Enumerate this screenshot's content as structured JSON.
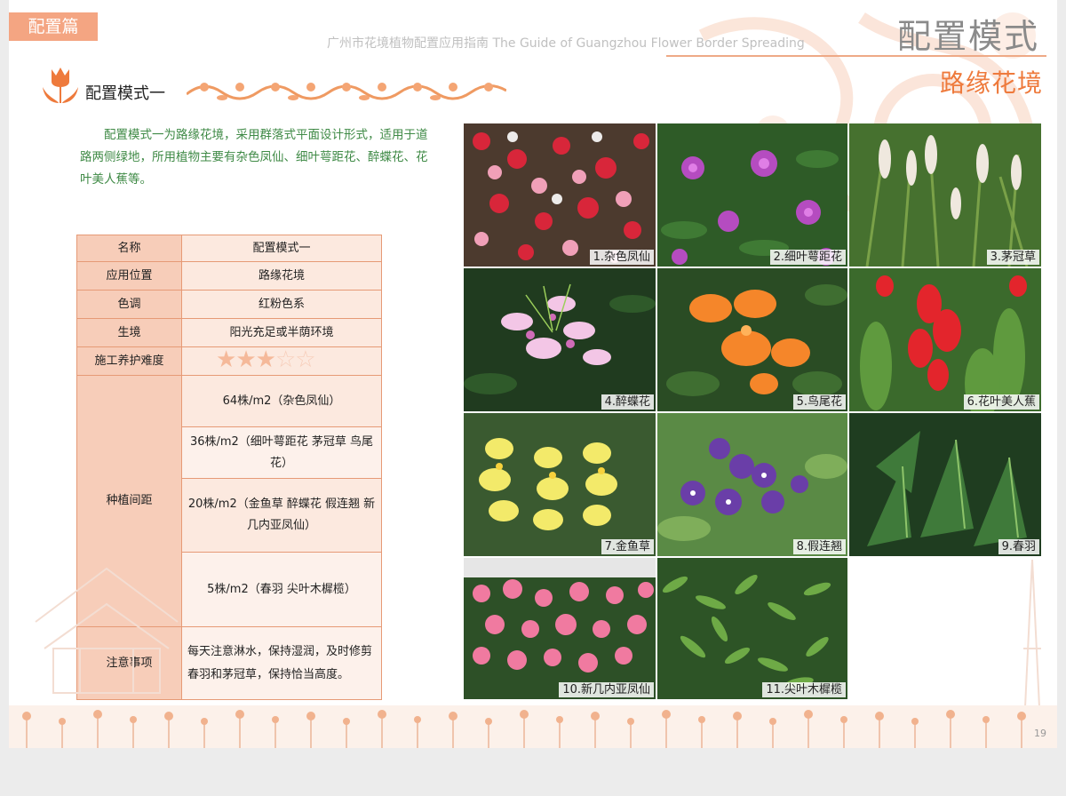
{
  "header": {
    "section_tab": "配置篇",
    "guide_title": "广州市花境植物配置应用指南 The Guide of Guangzhou Flower Border Spreading",
    "main_title": "配置模式",
    "sub_title": "路缘花境"
  },
  "section": {
    "heading": "配置模式一",
    "intro": "配置模式一为路缘花境，采用群落式平面设计形式，适用于道路两侧绿地，所用植物主要有杂色凤仙、细叶萼距花、醉蝶花、花叶美人蕉等。"
  },
  "table": {
    "name_label": "名称",
    "name_value": "配置模式一",
    "position_label": "应用位置",
    "position_value": "路缘花境",
    "tone_label": "色调",
    "tone_value": "红粉色系",
    "habitat_label": "生境",
    "habitat_value": "阳光充足或半荫环境",
    "difficulty_label": "施工养护难度",
    "difficulty_stars": 3,
    "difficulty_max": 5,
    "spacing_label": "种植间距",
    "spacing": [
      "64株/m2（杂色凤仙）",
      "36株/m2（细叶萼距花 茅冠草 鸟尾花）",
      "20株/m2（金鱼草 醉蝶花 假连翘 新几内亚凤仙）",
      "5株/m2（春羽 尖叶木樨榄）"
    ],
    "notes_label": "注意事项",
    "notes_value": "每天注意淋水，保持湿润，及时修剪春羽和茅冠草，保持恰当高度。"
  },
  "photos": [
    {
      "caption": "1.杂色凤仙"
    },
    {
      "caption": "2.细叶萼距花"
    },
    {
      "caption": "3.茅冠草"
    },
    {
      "caption": "4.醉蝶花"
    },
    {
      "caption": "5.鸟尾花"
    },
    {
      "caption": "6.花叶美人蕉"
    },
    {
      "caption": "7.金鱼草"
    },
    {
      "caption": "8.假连翘"
    },
    {
      "caption": "9.春羽"
    },
    {
      "caption": "10.新几内亚凤仙"
    },
    {
      "caption": "11.尖叶木樨榄"
    }
  ],
  "footer": {
    "page_number": "19"
  },
  "colors": {
    "accent_orange": "#ee7a3c",
    "tab_orange": "#f4a582",
    "table_border": "#e69a76",
    "intro_green": "#3f8a46"
  }
}
